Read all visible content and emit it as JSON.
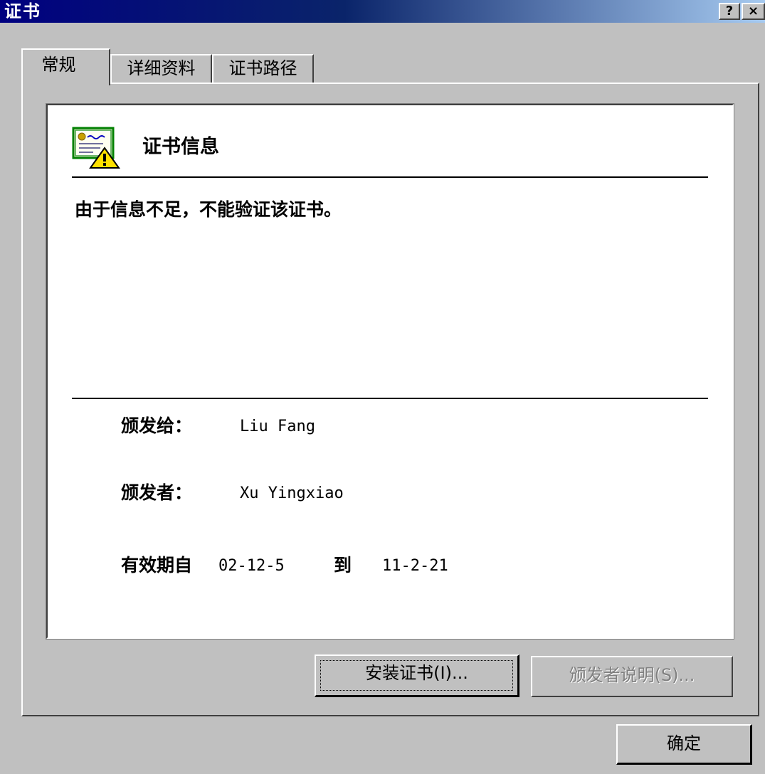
{
  "window": {
    "title": "证书",
    "help_glyph": "?",
    "close_glyph": "×"
  },
  "tabs": [
    {
      "label": "常规",
      "active": true
    },
    {
      "label": "详细资料",
      "active": false
    },
    {
      "label": "证书路径",
      "active": false
    }
  ],
  "info": {
    "icon": "certificate-warning-icon",
    "title": "证书信息",
    "message": "由于信息不足，不能验证该证书。"
  },
  "fields": {
    "issued_to_label": "颁发给：",
    "issued_to_value": "Liu Fang",
    "issued_by_label": "颁发者：",
    "issued_by_value": "Xu Yingxiao",
    "valid_from_label": "有效期自",
    "valid_from_value": "02-12-5",
    "valid_to_label": "到",
    "valid_to_value": "11-2-21"
  },
  "buttons": {
    "install": "安装证书(I)...",
    "issuer_statement": "颁发者说明(S)...",
    "ok": "确定"
  }
}
